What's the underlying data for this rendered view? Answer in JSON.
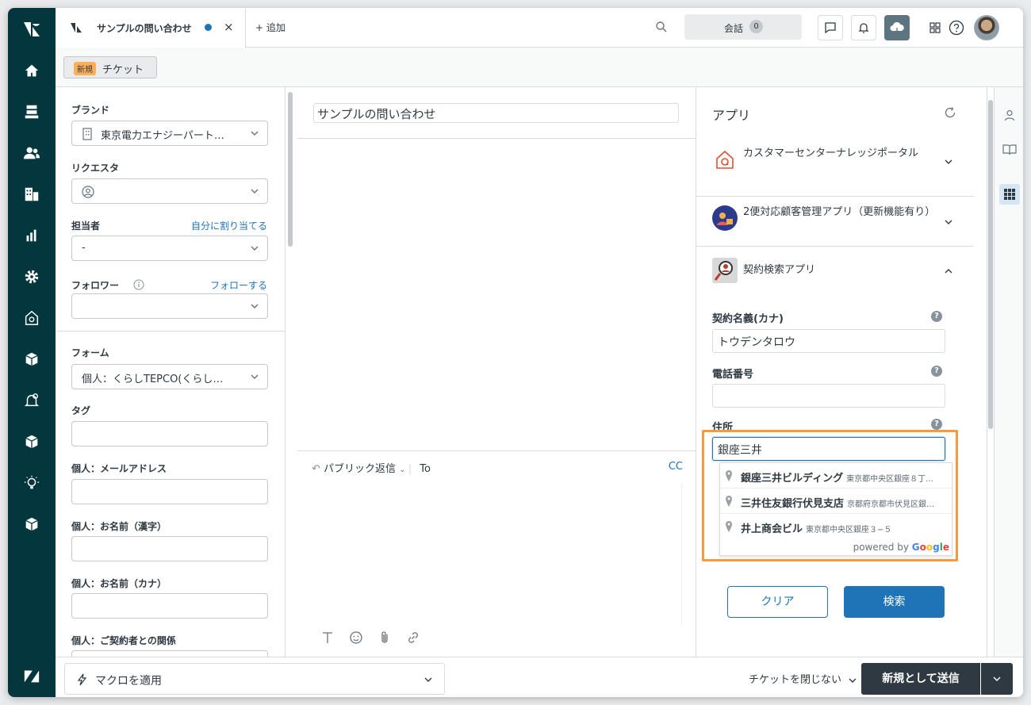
{
  "tab": {
    "title": "サンプルの問い合わせ",
    "close": "×"
  },
  "topbar": {
    "add_label": "+ 追加",
    "conversations_label": "会話",
    "conversations_count": "0"
  },
  "subbar": {
    "new_badge": "新規",
    "ticket_label": "チケット"
  },
  "left": {
    "brand_label": "ブランド",
    "brand_value": "東京電力エナジーパート…",
    "requester_label": "リクエスタ",
    "assignee_label": "担当者",
    "assign_self": "自分に割り当てる",
    "assignee_value": "-",
    "follower_label": "フォロワー",
    "follow_link": "フォローする",
    "form_label": "フォーム",
    "form_value": "個人：くらしTEPCO(くらし…",
    "tags_label": "タグ",
    "email_label": "個人：メールアドレス",
    "name_kanji_label": "個人：お名前（漢字）",
    "name_kana_label": "個人：お名前（カナ）",
    "relation_label": "個人：ご契約者との関係"
  },
  "center": {
    "subject": "サンプルの問い合わせ",
    "reply_mode": "パブリック返信",
    "to_label": "To",
    "cc_label": "CC"
  },
  "apps": {
    "title": "アプリ",
    "app1": "カスタマーセンターナレッジポータル",
    "app2": "2便対応顧客管理アプリ（更新機能有り）",
    "app3": "契約検索アプリ",
    "contract_name_label": "契約名義(カナ)",
    "contract_name_value": "トウデンタロウ",
    "phone_label": "電話番号",
    "phone_value": "",
    "address_label": "住所",
    "address_value": "銀座三井",
    "help_mark": "?",
    "suggestions": [
      {
        "main": "銀座三井ビルディング",
        "sub": "東京都中央区銀座８丁…"
      },
      {
        "main": "三井住友銀行伏見支店",
        "sub": "京都府京都市伏見区銀…"
      },
      {
        "main": "井上商会ビル",
        "sub": "東京都中央区銀座３−５"
      }
    ],
    "powered_by": "powered by",
    "google": [
      "G",
      "o",
      "o",
      "g",
      "l",
      "e"
    ],
    "google_colors": [
      "#4285f4",
      "#ea4335",
      "#fbbc05",
      "#4285f4",
      "#34a853",
      "#ea4335"
    ],
    "clear_button": "クリア",
    "search_button": "検索",
    "highlight_color": "#f79a3e"
  },
  "footer": {
    "macro": "マクロを適用",
    "close_option": "チケットを閉じない",
    "submit": "新規として送信"
  }
}
